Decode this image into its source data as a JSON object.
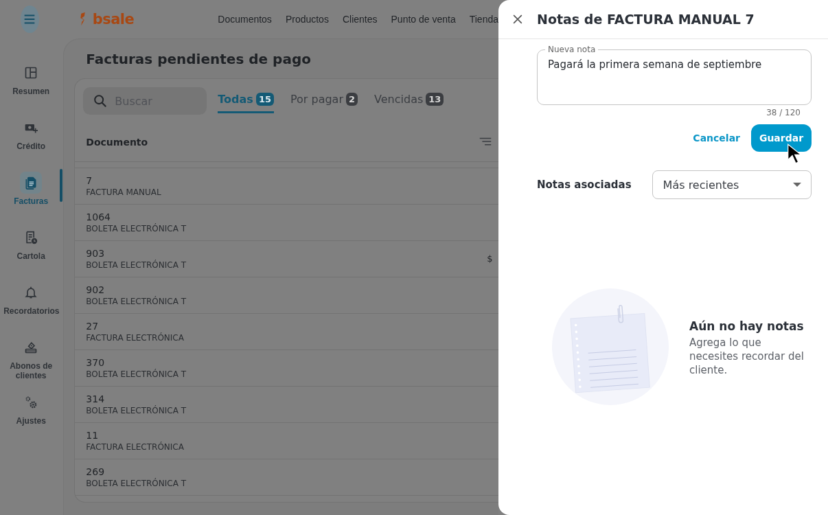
{
  "topbar": {
    "logo": "bsale",
    "nav": [
      "Documentos",
      "Productos",
      "Clientes",
      "Punto de venta",
      "Tienda"
    ]
  },
  "sidebar": {
    "items": [
      {
        "label": "Resumen",
        "selected": false
      },
      {
        "label": "Crédito",
        "selected": false
      },
      {
        "label": "Facturas",
        "selected": true
      },
      {
        "label": "Cartola",
        "selected": false
      },
      {
        "label": "Recordatorios",
        "selected": false
      },
      {
        "label": "Abonos de clientes",
        "selected": false
      },
      {
        "label": "Ajustes",
        "selected": false
      }
    ]
  },
  "page": {
    "title": "Facturas pendientes de pago",
    "search": {
      "placeholder": "Buscar"
    },
    "tabs": [
      {
        "label": "Todas",
        "count": "15",
        "selected": true
      },
      {
        "label": "Por pagar",
        "count": "2",
        "selected": false
      },
      {
        "label": "Vencidas",
        "count": "13",
        "selected": false
      }
    ],
    "table": {
      "columns": [
        "Documento"
      ],
      "rows": [
        {
          "number": "7",
          "type": "FACTURA MANUAL"
        },
        {
          "number": "1064",
          "type": "BOLETA ELECTRÓNICA T"
        },
        {
          "number": "903",
          "type": "BOLETA ELECTRÓNICA T",
          "column_2": "$"
        },
        {
          "number": "902",
          "type": "BOLETA ELECTRÓNICA T"
        },
        {
          "number": "27",
          "type": "FACTURA ELECTRÓNICA"
        },
        {
          "number": "370",
          "type": "BOLETA ELECTRÓNICA T"
        },
        {
          "number": "314",
          "type": "BOLETA ELECTRÓNICA T"
        },
        {
          "number": "11",
          "type": "FACTURA ELECTRÓNICA"
        },
        {
          "number": "269",
          "type": "BOLETA ELECTRÓNICA T"
        }
      ]
    }
  },
  "drawer": {
    "title": "Notas de FACTURA MANUAL 7",
    "note_field": {
      "label": "Nueva nota",
      "value": "Pagará la primera semana de septiembre",
      "counter": "38 / 120"
    },
    "buttons": {
      "cancel": "Cancelar",
      "save": "Guardar"
    },
    "associated": {
      "label": "Notas asociadas",
      "sort": "Más recientes"
    },
    "empty": {
      "title": "Aún no hay notas",
      "text": "Agrega lo que necesites recordar del cliente."
    }
  }
}
